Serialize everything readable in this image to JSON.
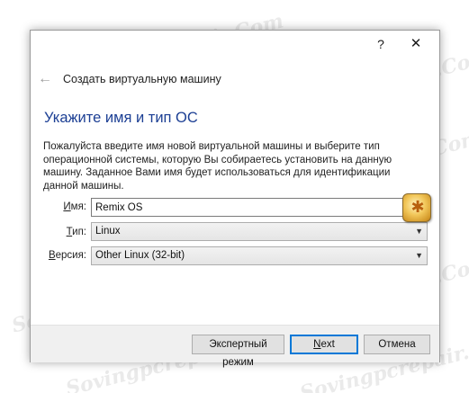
{
  "window": {
    "help_label": "?",
    "close_label": "✕"
  },
  "wizard": {
    "back_arrow": "←",
    "title": "Создать виртуальную машину",
    "heading": "Укажите имя и тип ОС",
    "description": "Пожалуйста введите имя новой виртуальной машины и выберите тип операционной системы, которую Вы собираетесь установить на данную машину. Заданное Вами имя будет использоваться для идентификации данной машины."
  },
  "form": {
    "name_label_u": "И",
    "name_label_rest": "мя:",
    "name_value": "Remix OS",
    "type_label_u": "Т",
    "type_label_rest": "ип:",
    "type_value": "Linux",
    "version_label_u": "В",
    "version_label_rest": "ерсия:",
    "version_value": "Other Linux (32-bit)",
    "os_icon": "linux-os-icon"
  },
  "buttons": {
    "expert": "Экспертный режим",
    "next_u": "N",
    "next_rest": "ext",
    "cancel": "Отмена"
  },
  "watermark": {
    "text": "Sovingpcrepair.Com"
  }
}
